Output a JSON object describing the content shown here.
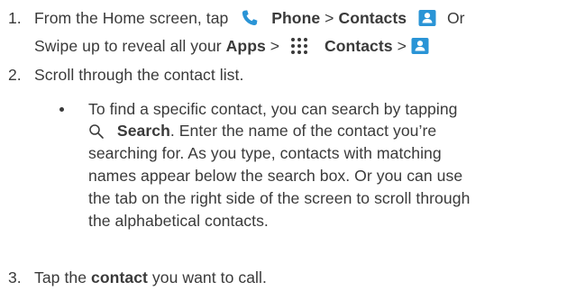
{
  "colors": {
    "text": "#3a3a3a",
    "accent": "#2a94d6"
  },
  "steps": [
    {
      "number": "1.",
      "line1": {
        "t1": "From the Home screen, tap",
        "phone": "Phone",
        "sep1": ">",
        "contacts": "Contacts",
        "or": "Or"
      },
      "line2": {
        "t1": "Swipe up to reveal all your",
        "apps": "Apps",
        "sep1": ">",
        "contacts": "Contacts",
        "sep2": ">"
      },
      "icons": [
        "phone-icon",
        "contacts-icon",
        "apps-grid-icon",
        "contacts-icon"
      ]
    },
    {
      "number": "2.",
      "text": "Scroll through the contact list."
    },
    {
      "number": "3.",
      "t1": "Tap the",
      "contact": "contact",
      "t2": "you want to call."
    }
  ],
  "bullet": {
    "line1": "To find a specific contact, you can search by tapping",
    "search": "Search",
    "line2_rest": ". Enter the name of the contact you’re",
    "line3": "searching for. As you type, contacts with matching",
    "line4": "names appear below the search box. Or you can use",
    "line5": "the tab on the right side of the screen to scroll through",
    "line6": "the alphabetical contacts.",
    "icon": "search-icon"
  }
}
